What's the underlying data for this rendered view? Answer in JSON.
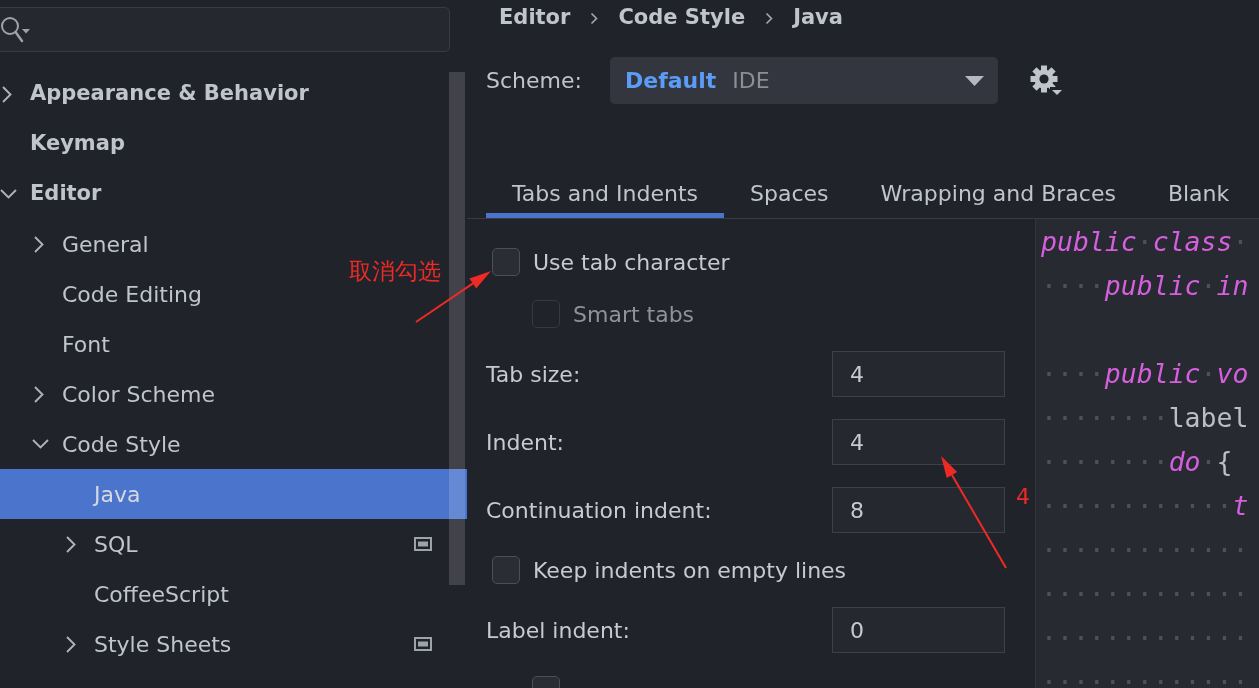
{
  "sidebar": {
    "items": [
      {
        "label": "Appearance & Behavior",
        "expanded": false,
        "selected": false,
        "project_level": false
      },
      {
        "label": "Keymap",
        "selected": false,
        "project_level": false
      },
      {
        "label": "Editor",
        "expanded": true,
        "selected": false,
        "project_level": false,
        "children": [
          {
            "label": "General",
            "expanded": false,
            "selected": false,
            "project_level": false
          },
          {
            "label": "Code Editing",
            "selected": false,
            "project_level": false
          },
          {
            "label": "Font",
            "selected": false,
            "project_level": false
          },
          {
            "label": "Color Scheme",
            "expanded": false,
            "selected": false,
            "project_level": false
          },
          {
            "label": "Code Style",
            "expanded": true,
            "selected": false,
            "project_level": false,
            "children": [
              {
                "label": "Java",
                "selected": true,
                "project_level": false
              },
              {
                "label": "SQL",
                "expanded": false,
                "selected": false,
                "project_level": true
              },
              {
                "label": "CoffeeScript",
                "selected": false,
                "project_level": false
              },
              {
                "label": "Style Sheets",
                "expanded": false,
                "selected": false,
                "project_level": true
              }
            ]
          }
        ]
      }
    ]
  },
  "breadcrumb": [
    "Editor",
    "Code Style",
    "Java"
  ],
  "scheme": {
    "label": "Scheme:",
    "name": "Default",
    "scope": "IDE"
  },
  "tabs": [
    {
      "label": "Tabs and Indents",
      "selected": true
    },
    {
      "label": "Spaces",
      "selected": false
    },
    {
      "label": "Wrapping and Braces",
      "selected": false
    },
    {
      "label": "Blank",
      "selected": false
    }
  ],
  "options": [
    {
      "kind": "checkbox",
      "label": "Use tab character",
      "checked": false,
      "disabled": false,
      "children": [
        {
          "kind": "checkbox",
          "label": "Smart tabs",
          "checked": false,
          "disabled": true
        }
      ]
    },
    {
      "kind": "number",
      "label": "Tab size:",
      "value": "4"
    },
    {
      "kind": "number",
      "label": "Indent:",
      "value": "4"
    },
    {
      "kind": "number",
      "label": "Continuation indent:",
      "value": "8"
    },
    {
      "kind": "checkbox",
      "label": "Keep indents on empty lines",
      "checked": false,
      "disabled": false
    },
    {
      "kind": "number",
      "label": "Label indent:",
      "value": "0",
      "children": [
        {
          "kind": "checkbox",
          "checked": false,
          "disabled": false
        }
      ]
    }
  ],
  "code_preview": {
    "lines": [
      {
        "kind": "code",
        "tokens": [
          {
            "kind": "keyword",
            "text": "public"
          },
          {
            "kind": "whitespace",
            "text": "·"
          },
          {
            "kind": "keyword",
            "text": "class"
          },
          {
            "kind": "whitespace",
            "text": "·"
          }
        ]
      },
      {
        "kind": "code",
        "tokens": [
          {
            "kind": "whitespace",
            "text": "····"
          },
          {
            "kind": "keyword",
            "text": "public"
          },
          {
            "kind": "whitespace",
            "text": "·"
          },
          {
            "kind": "keyword",
            "text": "in"
          }
        ]
      },
      {
        "kind": "blank"
      },
      {
        "kind": "code",
        "tokens": [
          {
            "kind": "whitespace",
            "text": "····"
          },
          {
            "kind": "keyword",
            "text": "public"
          },
          {
            "kind": "whitespace",
            "text": "·"
          },
          {
            "kind": "keyword",
            "text": "vo"
          }
        ]
      },
      {
        "kind": "code",
        "tokens": [
          {
            "kind": "whitespace",
            "text": "········"
          },
          {
            "kind": "plain",
            "text": "label"
          }
        ]
      },
      {
        "kind": "code",
        "tokens": [
          {
            "kind": "whitespace",
            "text": "········"
          },
          {
            "kind": "keyword",
            "text": "do"
          },
          {
            "kind": "whitespace",
            "text": "·"
          },
          {
            "kind": "plain",
            "text": "{"
          }
        ]
      },
      {
        "kind": "code",
        "tokens": [
          {
            "kind": "whitespace",
            "text": "············"
          },
          {
            "kind": "keyword",
            "text": "t"
          }
        ]
      },
      {
        "kind": "code",
        "tokens": [
          {
            "kind": "whitespace",
            "text": "·············"
          }
        ]
      },
      {
        "kind": "code",
        "tokens": [
          {
            "kind": "whitespace",
            "text": "·············"
          }
        ]
      },
      {
        "kind": "code",
        "tokens": [
          {
            "kind": "whitespace",
            "text": "·············"
          }
        ]
      },
      {
        "kind": "code",
        "tokens": [
          {
            "kind": "whitespace",
            "text": "·············"
          }
        ]
      }
    ]
  },
  "annotations": [
    {
      "kind": "label",
      "text": "取消勾选"
    },
    {
      "kind": "arrow"
    },
    {
      "kind": "arrow"
    },
    {
      "kind": "label",
      "text": "4"
    }
  ]
}
